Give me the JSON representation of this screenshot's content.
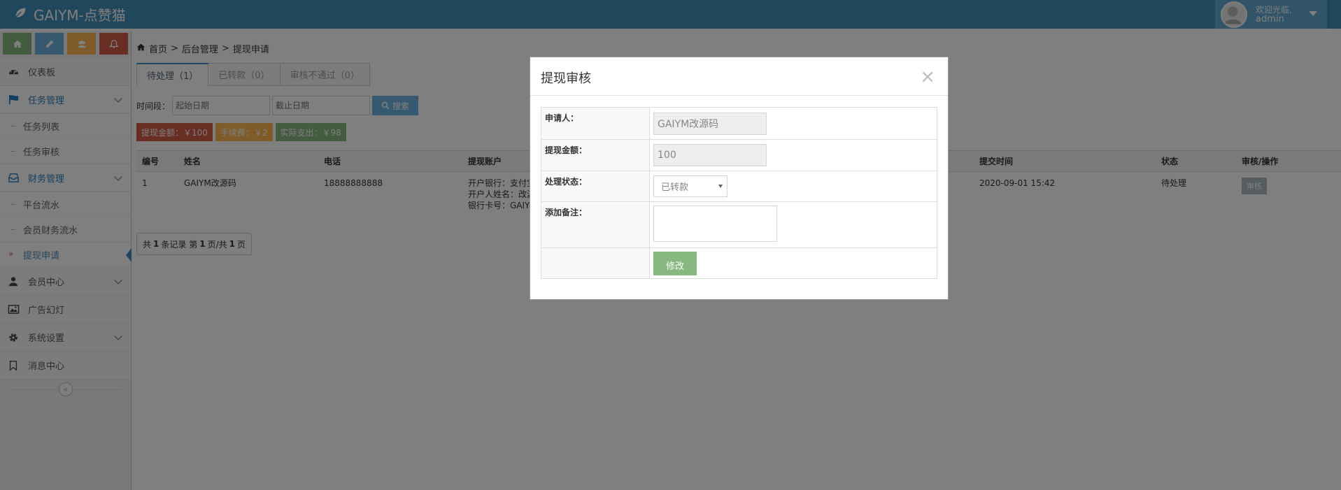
{
  "app": {
    "brand": "GAIYM-点赞猫"
  },
  "user": {
    "welcome": "欢迎光临,",
    "name": "admin"
  },
  "colors": {
    "navbar": "#438eb9",
    "green": "#87b87f",
    "blue": "#6fb3e0",
    "orange": "#ffb752",
    "red": "#d15b47"
  },
  "shortcuts": [
    {
      "icon": "home-icon",
      "color": "#87b87f"
    },
    {
      "icon": "pencil-icon",
      "color": "#6fb3e0"
    },
    {
      "icon": "users-icon",
      "color": "#ffb752"
    },
    {
      "icon": "bell-icon",
      "color": "#d15b47"
    }
  ],
  "sidebar": {
    "dashboard": "仪表板",
    "task_mgmt": "任务管理",
    "task_list": "任务列表",
    "task_audit": "任务审核",
    "finance_mgmt": "财务管理",
    "platform_flow": "平台流水",
    "member_finance": "会员财务流水",
    "withdraw_request": "提现申请",
    "member_center": "会员中心",
    "ad_slides": "广告幻灯",
    "system_settings": "系统设置",
    "message_center": "消息中心",
    "collapse": "«"
  },
  "breadcrumb": {
    "home": "首页",
    "sep1": ">",
    "admin": "后台管理",
    "sep2": ">",
    "current": "提现申请"
  },
  "tabs": [
    {
      "label": "待处理（1）"
    },
    {
      "label": "已转款（0）"
    },
    {
      "label": "审核不通过（0）"
    }
  ],
  "filter": {
    "label": "时间段：",
    "start_placeholder": "起始日期",
    "end_placeholder": "截止日期",
    "search": "搜索"
  },
  "summary": {
    "amount": "提现金额：￥100",
    "fee": "手续费：￥2",
    "actual": "实际支出：￥98"
  },
  "table": {
    "headers": [
      "编号",
      "姓名",
      "电话",
      "提现账户",
      "提交时间",
      "状态",
      "审核/操作"
    ],
    "rows": [
      {
        "id": "1",
        "name": "GAIYM改源码",
        "phone": "18888888888",
        "account_bank": "开户银行：支付宝",
        "account_holder": "开户人姓名：改源码",
        "account_no": "银行卡号：GAIYM",
        "time": "2020-09-01 15:42",
        "status": "待处理",
        "action": "审核"
      }
    ]
  },
  "pager": {
    "pre": "共",
    "total": "1",
    "mid1": "条记录 第",
    "page": "1",
    "mid2": "页/共",
    "pages": "1",
    "post": "页"
  },
  "modal": {
    "title": "提现审核",
    "close": "×",
    "applicant_label": "申请人：",
    "applicant_value": "GAIYM改源码",
    "amount_label": "提现金额：",
    "amount_value": "100",
    "status_label": "处理状态：",
    "status_value": "已转款",
    "note_label": "添加备注：",
    "submit": "修改"
  }
}
